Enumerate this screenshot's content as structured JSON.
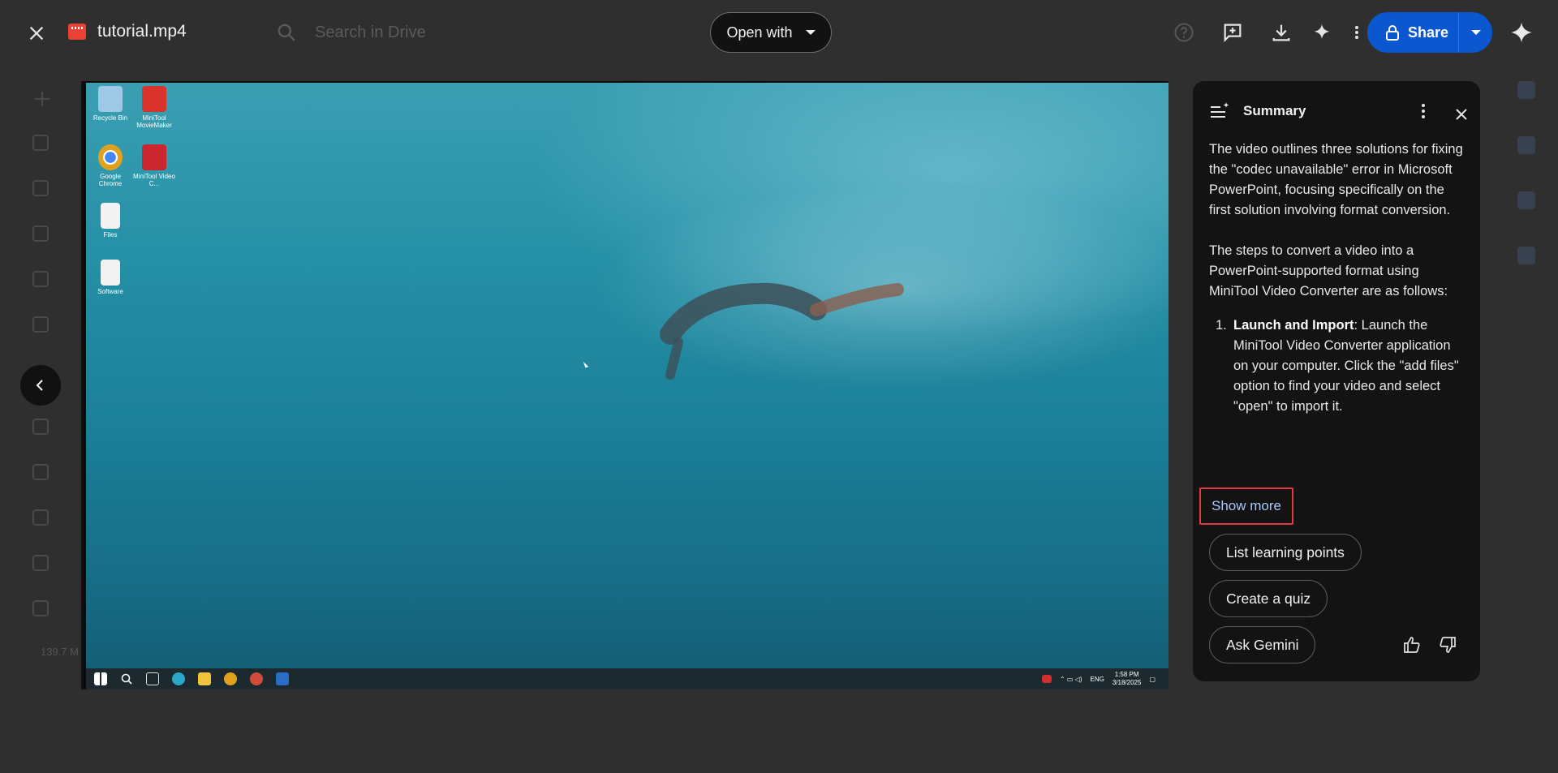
{
  "header": {
    "file_name": "tutorial.mp4",
    "open_with_label": "Open with",
    "share_label": "Share",
    "search_placeholder": "Search in Drive"
  },
  "background": {
    "storage_text": "139.7 M"
  },
  "video": {
    "desktop_icons": [
      {
        "label": "Recycle Bin",
        "color": "#9fc7e6"
      },
      {
        "label": "MiniTool MovieMaker",
        "color": "#d9342b"
      },
      {
        "label": "Google Chrome",
        "color": "#e0a21e"
      },
      {
        "label": "MiniTool Video C...",
        "color": "#c9262d"
      },
      {
        "label": "Files",
        "color": "#f2f2f2"
      },
      {
        "label": "Software",
        "color": "#f2f2f2"
      }
    ],
    "tray": {
      "lang": "ENG",
      "time": "1:58 PM",
      "date": "3/18/2025"
    }
  },
  "summary": {
    "title": "Summary",
    "para1": "The video outlines three solutions for fixing the \"codec unavailable\" error in Microsoft PowerPoint, focusing specifically on the first solution involving format conversion.",
    "para2": "The steps to convert a video into a PowerPoint-supported format using MiniTool Video Converter are as follows:",
    "step1_number": "1.",
    "step1_title": "Launch and Import",
    "step1_text": ": Launch the MiniTool Video Converter application on your computer. Click the \"add files\" option to find your video and select \"open\" to import it.",
    "show_more": "Show more",
    "chips": [
      "List learning points",
      "Create a quiz",
      "Ask Gemini"
    ]
  },
  "colors": {
    "accent_blue": "#0b57d0",
    "link_blue": "#a8c7fa",
    "highlight_red": "#e0393e"
  }
}
